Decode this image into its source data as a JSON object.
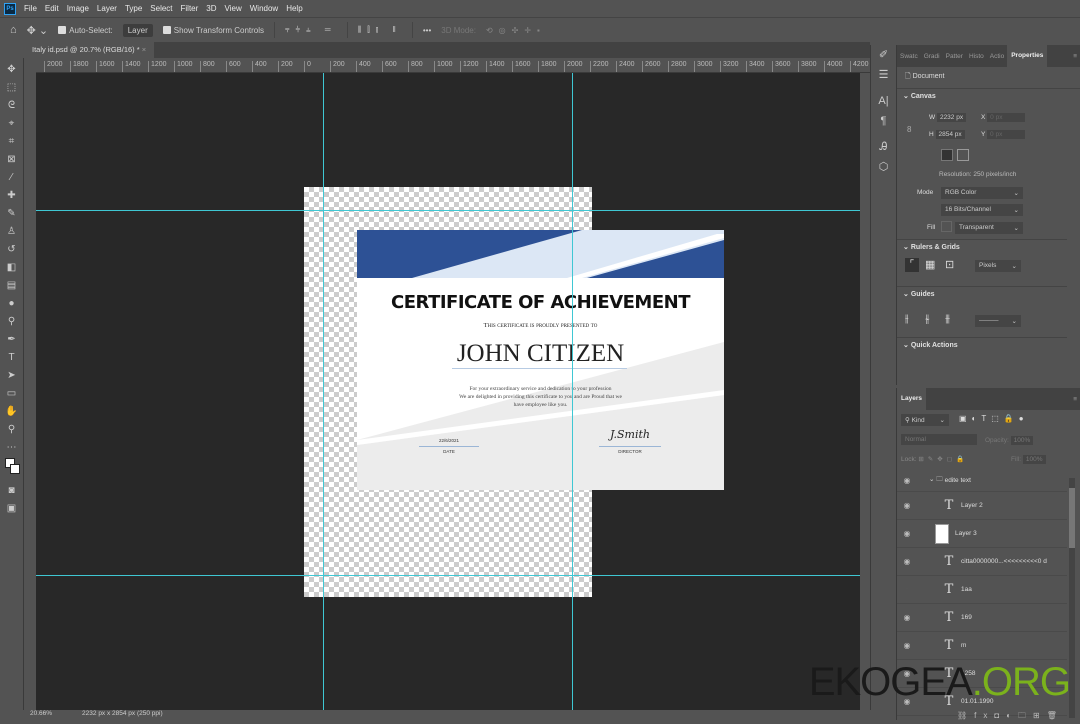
{
  "app": {
    "logo": "Ps",
    "menu": [
      "File",
      "Edit",
      "Image",
      "Layer",
      "Type",
      "Select",
      "Filter",
      "3D",
      "View",
      "Window",
      "Help"
    ]
  },
  "options": {
    "auto_select": "Auto-Select:",
    "layer_select": "Layer",
    "show_transform": "Show Transform Controls",
    "more": "•••",
    "mode_3d": "3D Mode:"
  },
  "document_tab": {
    "title": "Italy id.psd @ 20.7% (RGB/16) *",
    "close": "×"
  },
  "ruler": {
    "labels": [
      "2000",
      "1800",
      "1600",
      "1400",
      "1200",
      "1000",
      "800",
      "600",
      "400",
      "200",
      "0",
      "200",
      "400",
      "600",
      "800",
      "1000",
      "1200",
      "1400",
      "1600",
      "1800",
      "2000",
      "2200",
      "2400",
      "2600",
      "2800",
      "3000",
      "3200",
      "3400",
      "3600",
      "3800",
      "4000",
      "4200"
    ]
  },
  "certificate": {
    "title": "CERTIFICATE OF ACHIEVEMENT",
    "subtitle": "This certificate is proudly presented to",
    "name": "JOHN CITIZEN",
    "body": [
      "For your extraordinary service and dedication to your profession",
      "We are delighted in providing this certificate to you and are Proud that we",
      "have employee like you."
    ],
    "date_value": "22/6/2021",
    "date_label": "DATE",
    "signature": "J.Smith",
    "director_label": "DIRECTOR",
    "colors": {
      "blue": "#2d5195",
      "light_blue": "#dce7f5",
      "gray": "#ececec"
    }
  },
  "status": {
    "zoom": "20.66%",
    "doc_info": "2232 px x 2854 px (250 ppi)"
  },
  "properties": {
    "tabs": [
      "Swatc",
      "Gradi",
      "Patter",
      "Histo",
      "Actio",
      "Properties"
    ],
    "document": "Document",
    "canvas_section": "Canvas",
    "w_label": "W",
    "w_value": "2232 px",
    "h_label": "H",
    "h_value": "2854 px",
    "x_label": "X",
    "x_value": "0 px",
    "y_label": "Y",
    "y_value": "0 px",
    "resolution": "Resolution: 250 pixels/inch",
    "mode_label": "Mode",
    "mode_value": "RGB Color",
    "depth_value": "16 Bits/Channel",
    "fill_label": "Fill",
    "fill_value": "Transparent",
    "rulers_section": "Rulers & Grids",
    "units_value": "Pixels",
    "guides_section": "Guides",
    "quick_actions": "Quick Actions"
  },
  "layers": {
    "title": "Layers",
    "kind": "Kind",
    "blend": "Normal",
    "opacity_label": "Opacity:",
    "opacity_value": "100%",
    "lock_label": "Lock:",
    "fill_label": "Fill:",
    "fill_value": "100%",
    "group": "edite text",
    "items": [
      "Layer 2",
      "Layer 3",
      "citta0000000...<<<<<<<<<0 d",
      "1aa",
      "169",
      "m",
      "1258",
      "01.01.1990"
    ]
  },
  "watermark": {
    "dark": "EKOGEA",
    "green": ".ORG"
  }
}
